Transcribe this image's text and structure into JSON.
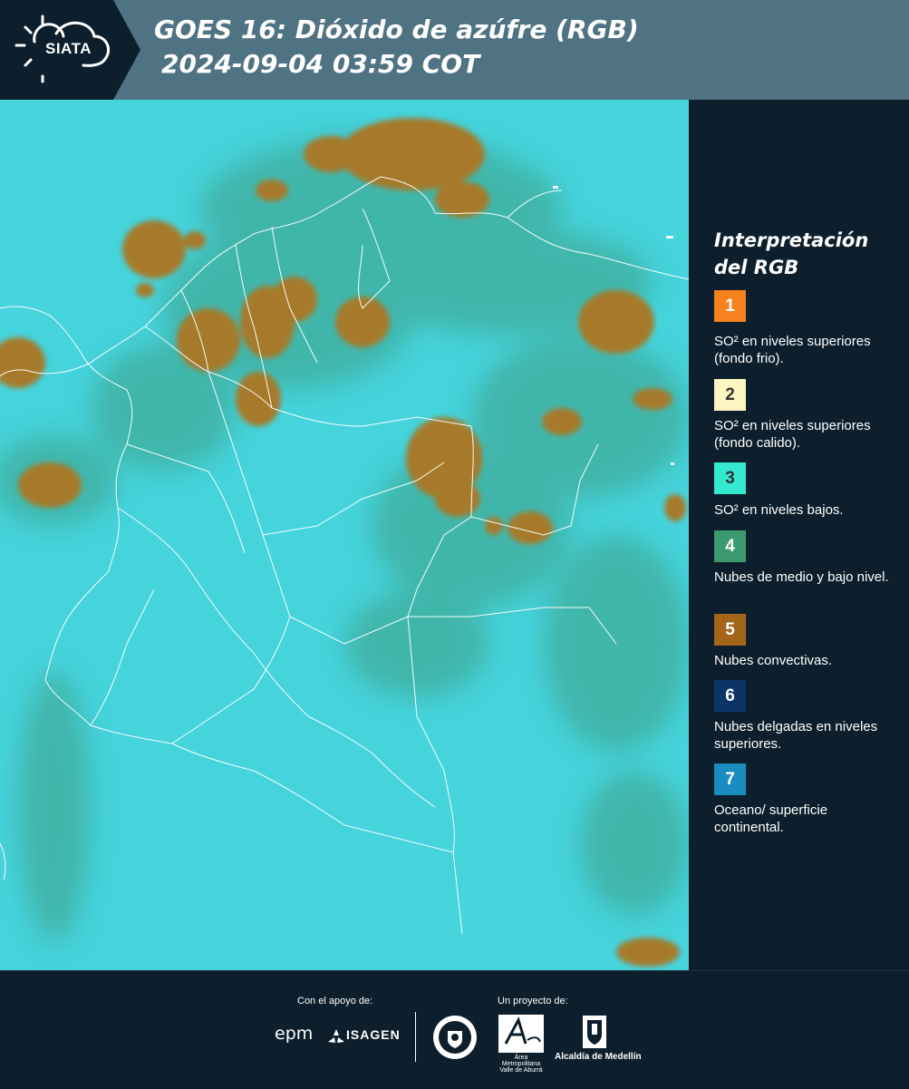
{
  "header": {
    "logo_text": "SIATA",
    "title_line1": "GOES 16: Dióxido de azúfre (RGB)",
    "title_line2": "2024-09-04 03:59 COT"
  },
  "legend": {
    "title": "Interpretación del RGB",
    "items": [
      {
        "number": "1",
        "color": "#f5821f",
        "text_color": "#ffffff",
        "text": "SO² en niveles superiores (fondo frio)."
      },
      {
        "number": "2",
        "color": "#fdf6c3",
        "text_color": "#333333",
        "text": "SO² en niveles superiores (fondo calido)."
      },
      {
        "number": "3",
        "color": "#35e8d0",
        "text_color": "#333333",
        "text": "SO² en niveles bajos."
      },
      {
        "number": "4",
        "color": "#3d9a6e",
        "text_color": "#ffffff",
        "text": "Nubes de medio y bajo nivel."
      },
      {
        "number": "5",
        "color": "#a5651b",
        "text_color": "#ffffff",
        "text": "Nubes convectivas."
      },
      {
        "number": "6",
        "color": "#0b3566",
        "text_color": "#ffffff",
        "text": "Nubes delgadas en niveles superiores."
      },
      {
        "number": "7",
        "color": "#1a8cc0",
        "text_color": "#ffffff",
        "text": "Oceano/ superficie continental."
      }
    ]
  },
  "footer": {
    "support_label": "Con el apoyo de:",
    "project_label": "Un proyecto de:",
    "sponsor1": "epm",
    "sponsor2": "ISAGEN",
    "partner_area": "Área Metropolitana Valle de Aburrá",
    "partner_alcaldia": "Alcaldía de Medellín"
  },
  "colors": {
    "header_bg": "#4f7382",
    "panel_bg": "#0d1f2c",
    "map_base": "#3fcfd8",
    "cloud_convective": "#a8772a",
    "cloud_mid": "#3d9a6e"
  }
}
